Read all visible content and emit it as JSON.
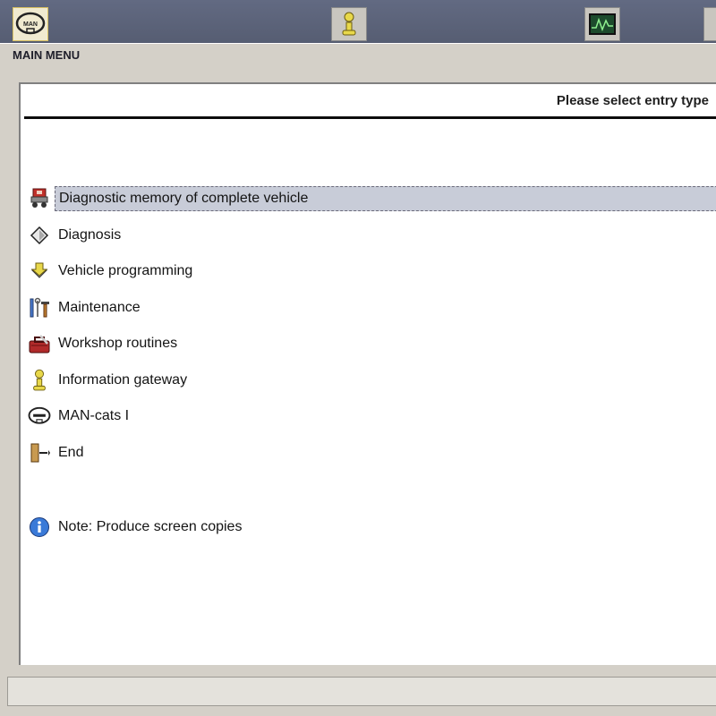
{
  "toolbar": {
    "buttons": [
      {
        "name": "man-logo-button",
        "icon": "man-logo-icon",
        "text": "MAN",
        "active": true
      },
      {
        "name": "information-button",
        "icon": "info-person-icon"
      },
      {
        "name": "measurement-button",
        "icon": "oscilloscope-icon"
      },
      {
        "name": "partial-button",
        "icon": "partial-icon"
      }
    ]
  },
  "window": {
    "title": "MAIN MENU"
  },
  "main": {
    "prompt": "Please select entry type",
    "items": [
      {
        "label": "Diagnostic memory of complete vehicle",
        "icon": "truck-diagnostic-icon",
        "selected": true
      },
      {
        "label": "Diagnosis",
        "icon": "diamond-icon"
      },
      {
        "label": "Vehicle programming",
        "icon": "programming-arrow-icon"
      },
      {
        "label": "Maintenance",
        "icon": "tools-icon"
      },
      {
        "label": "Workshop routines",
        "icon": "toolbox-icon"
      },
      {
        "label": "Information gateway",
        "icon": "info-person-icon"
      },
      {
        "label": "MAN-cats I",
        "icon": "man-logo-icon"
      },
      {
        "label": "End",
        "icon": "exit-door-icon"
      }
    ],
    "note": {
      "label": "Note: Produce screen copies",
      "icon": "info-circle-icon"
    }
  },
  "colors": {
    "toolbar": "#5b6278",
    "selection": "#c8ccd8",
    "window": "#d4d0c8"
  }
}
